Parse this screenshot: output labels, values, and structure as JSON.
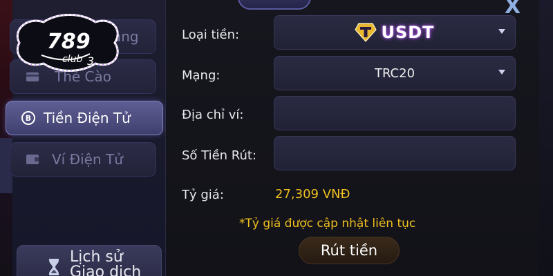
{
  "sidebar": {
    "items": [
      {
        "label": "Ngân Hàng",
        "visible_label": "àng",
        "icon": "bank-icon"
      },
      {
        "label": "Thẻ Cào",
        "icon": "card-icon"
      },
      {
        "label": "Tiền Điện Tử",
        "icon": "coin-b-icon",
        "active": true
      },
      {
        "label": "Ví Điện Tử",
        "icon": "wallet-icon"
      }
    ],
    "history": {
      "line1": "Lịch sử",
      "line2": "Giao dịch"
    }
  },
  "logo": {
    "main": "789",
    "sub": "club",
    "suffix": "3"
  },
  "form": {
    "currency": {
      "label": "Loại tiền:",
      "value": "USDT"
    },
    "network": {
      "label": "Mạng:",
      "value": "TRC20"
    },
    "wallet_address": {
      "label": "Địa chỉ ví:",
      "value": ""
    },
    "amount": {
      "label": "Số Tiền Rút:",
      "value": ""
    },
    "rate": {
      "label": "Tỷ giá:",
      "value": "27,309 VNĐ"
    },
    "note": "*Tỷ giá được cập nhật liên tục",
    "submit_label": "Rút tiền"
  },
  "header": {
    "close_label": "X"
  },
  "colors": {
    "accent": "#f0c020",
    "usdt_glow": "#c060ff",
    "active_tab": "#5e5e94"
  }
}
